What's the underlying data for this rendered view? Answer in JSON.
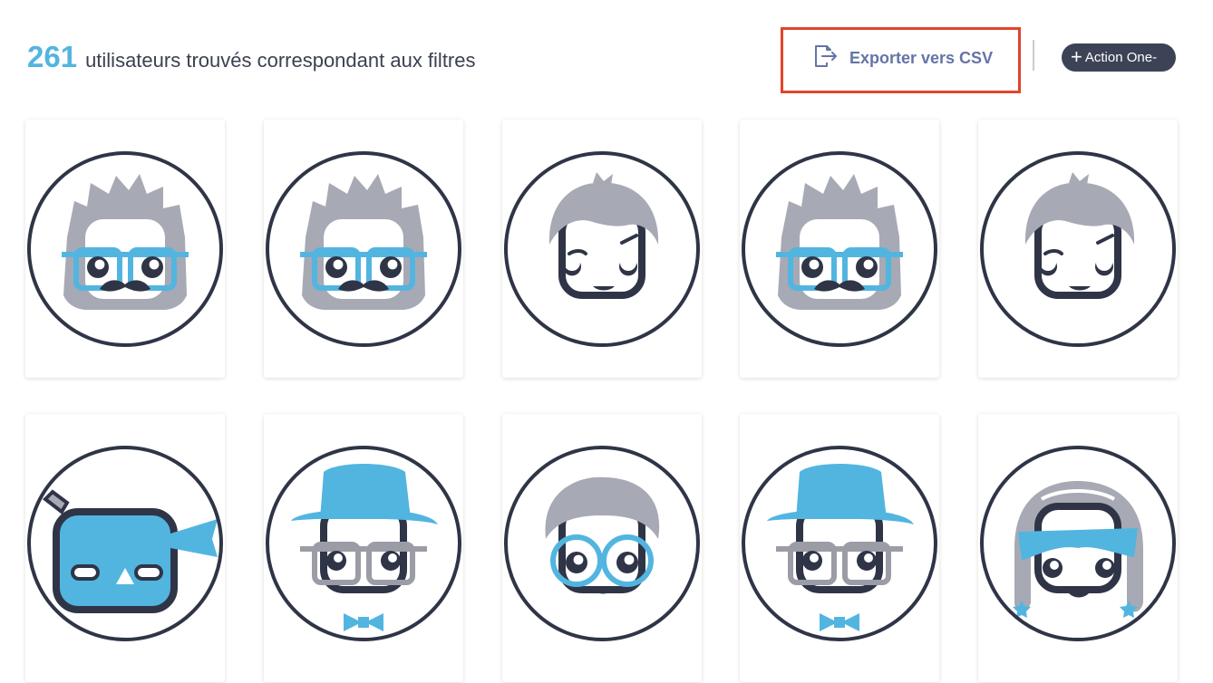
{
  "header": {
    "count": "261",
    "title_text": "utilisateurs trouvés correspondant aux filtres",
    "export_label": "Exporter vers CSV",
    "export_icon": "export-file-icon",
    "action_plus": "+",
    "action_label": "Action One-"
  },
  "colors": {
    "accent": "#52b5e0",
    "title": "#3b4150",
    "export_text": "#6474a8",
    "highlight_border": "#e0452c",
    "action_bg": "#3d4356",
    "avatar_outline": "#2f3547",
    "avatar_hair": "#a7a9b4"
  },
  "users": [
    {
      "avatar": "grey-hair-glasses-mustache"
    },
    {
      "avatar": "grey-hair-glasses-mustache"
    },
    {
      "avatar": "grey-hair-smirk"
    },
    {
      "avatar": "grey-hair-glasses-mustache"
    },
    {
      "avatar": "grey-hair-smirk"
    },
    {
      "avatar": "blue-ninja-mask"
    },
    {
      "avatar": "blue-hat-glasses-bowtie"
    },
    {
      "avatar": "grey-hair-round-glasses"
    },
    {
      "avatar": "blue-hat-glasses-bowtie"
    },
    {
      "avatar": "girl-blue-bandana-star-earrings"
    }
  ]
}
